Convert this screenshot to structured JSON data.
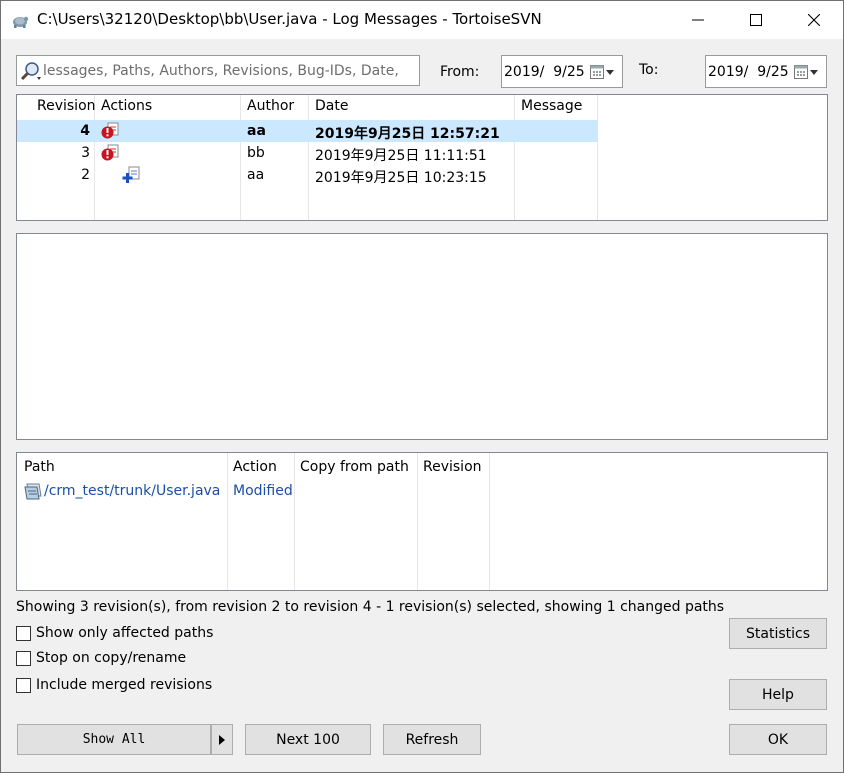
{
  "window": {
    "title": "C:\\Users\\32120\\Desktop\\bb\\User.java - Log Messages - TortoiseSVN"
  },
  "filter": {
    "search_placeholder": "lessages, Paths, Authors, Revisions, Bug-IDs, Date,",
    "from_label": "From:",
    "from_value": "2019/  9/25",
    "to_label": "To:",
    "to_value": "2019/  9/25"
  },
  "revisions": {
    "columns": [
      "Revision",
      "Actions",
      "Author",
      "Date",
      "Message"
    ],
    "rows": [
      {
        "revision": "4",
        "author": "aa",
        "date": "2019年9月25日 12:57:21",
        "message": "",
        "selected": true,
        "action_icon": "conflict-modified-icon"
      },
      {
        "revision": "3",
        "author": "bb",
        "date": "2019年9月25日 11:11:51",
        "message": "",
        "selected": false,
        "action_icon": "conflict-modified-icon"
      },
      {
        "revision": "2",
        "author": "aa",
        "date": "2019年9月25日 10:23:15",
        "message": "",
        "selected": false,
        "action_icon": "added-icon"
      }
    ]
  },
  "changed_paths": {
    "columns": [
      "Path",
      "Action",
      "Copy from path",
      "Revision"
    ],
    "rows": [
      {
        "path": "/crm_test/trunk/User.java",
        "action": "Modified",
        "copy_from": "",
        "revision": ""
      }
    ]
  },
  "status_text": "Showing 3 revision(s), from revision 2 to revision 4 - 1 revision(s) selected, showing 1 changed paths",
  "options": {
    "show_affected": "Show only affected paths",
    "stop_on_copy": "Stop on copy/rename",
    "include_merged": "Include merged revisions"
  },
  "buttons": {
    "statistics": "Statistics",
    "help": "Help",
    "show_all": "Show All",
    "next_100": "Next 100",
    "refresh": "Refresh",
    "ok": "OK"
  },
  "colors": {
    "selection": "#cce8ff",
    "link_blue": "#1a4ea8",
    "button_face": "#e1e1e1"
  }
}
